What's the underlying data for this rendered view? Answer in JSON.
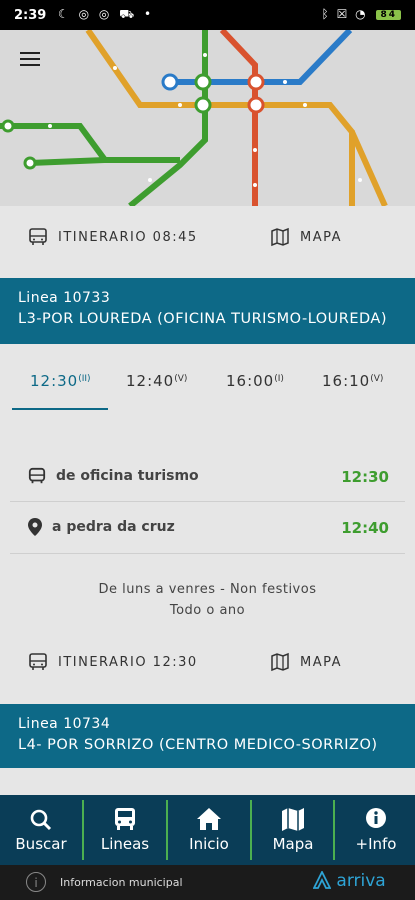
{
  "status_bar": {
    "time": "2:39",
    "left_icons": [
      "moon-icon",
      "notification-icon",
      "notification-icon",
      "car-icon",
      "dot"
    ],
    "right_icons": [
      "bluetooth-icon",
      "close-box-icon",
      "wifi-icon"
    ],
    "battery": "84"
  },
  "header": {
    "menu_icon": "menu-icon"
  },
  "actions_top": {
    "itinerary_label": "ITINERARIO 08:45",
    "map_label": "MAPA"
  },
  "line1": {
    "number": "Linea 10733",
    "name": "L3-POR LOUREDA (OFICINA TURISMO-LOUREDA)"
  },
  "tabs": [
    {
      "time": "12:30",
      "suffix": "(II)"
    },
    {
      "time": "12:40",
      "suffix": "(V)"
    },
    {
      "time": "16:00",
      "suffix": "(I)"
    },
    {
      "time": "16:10",
      "suffix": "(V)"
    }
  ],
  "stops": [
    {
      "label": "de oficina turismo",
      "time": "12:30",
      "icon": "bus-icon"
    },
    {
      "label": "a pedra da cruz",
      "time": "12:40",
      "icon": "location-pin-icon"
    }
  ],
  "schedule": {
    "days": "De luns a venres - Non festivos",
    "period": "Todo o ano"
  },
  "actions_bottom": {
    "itinerary_label": "ITINERARIO 12:30",
    "map_label": "MAPA"
  },
  "line2": {
    "number": "Linea 10734",
    "name": "L4- POR SORRIZO (CENTRO MEDICO-SORRIZO)"
  },
  "bottom_nav": [
    {
      "label": "Buscar",
      "icon": "search-icon"
    },
    {
      "label": "Lineas",
      "icon": "bus-icon"
    },
    {
      "label": "Inicio",
      "icon": "home-icon"
    },
    {
      "label": "Mapa",
      "icon": "map-icon"
    },
    {
      "label": "+Info",
      "icon": "info-icon"
    }
  ],
  "footer": {
    "text": "Informacion municipal",
    "brand": "arriva"
  },
  "colors": {
    "primary": "#0d6987",
    "nav": "#0a3d57",
    "accent_green": "#3e9d2f",
    "brand": "#2ea4d6"
  }
}
